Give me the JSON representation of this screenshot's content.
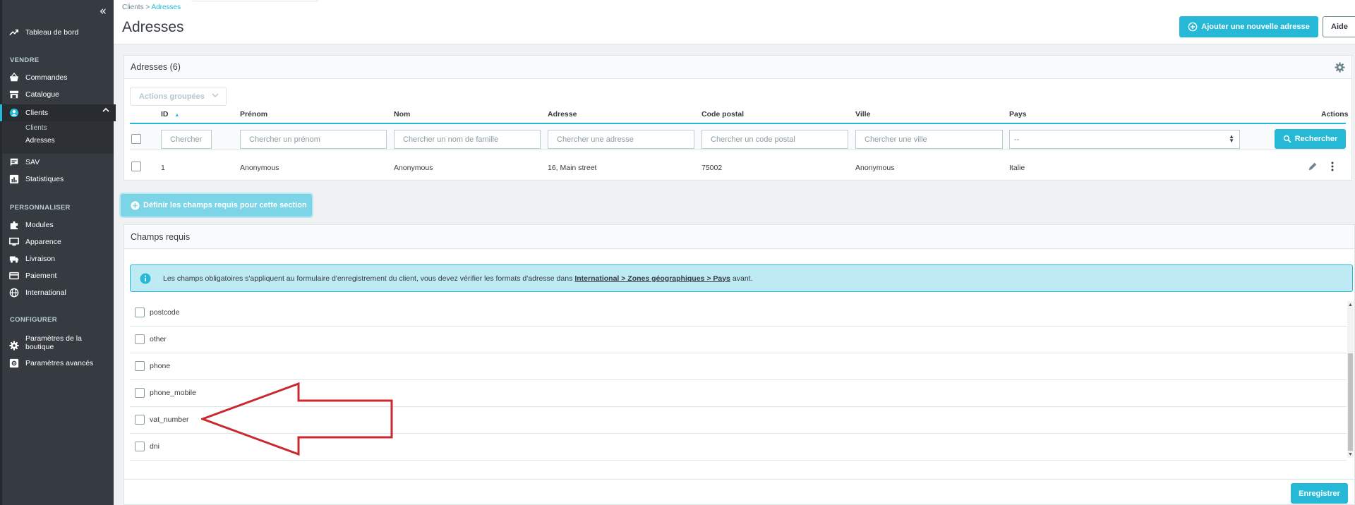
{
  "sidebar": {
    "collapse_icon": "«",
    "dashboard": "Tableau de bord",
    "section_sell": "VENDRE",
    "orders": "Commandes",
    "catalog": "Catalogue",
    "customers": "Clients",
    "sub_customers": "Clients",
    "sub_addresses": "Adresses",
    "support": "SAV",
    "stats": "Statistiques",
    "section_customize": "PERSONNALISER",
    "modules": "Modules",
    "appearance": "Apparence",
    "shipping": "Livraison",
    "payment": "Paiement",
    "international": "International",
    "section_configure": "CONFIGURER",
    "shop_params_1": "Paramètres de la",
    "shop_params_2": "boutique",
    "advanced_params": "Paramètres avancés"
  },
  "header": {
    "breadcrumb_parent": "Clients",
    "breadcrumb_sep": ">",
    "breadcrumb_current": "Adresses",
    "title": "Adresses",
    "add_button": "Ajouter une nouvelle adresse",
    "help_button": "Aide"
  },
  "addresses": {
    "title": "Adresses (6)",
    "bulk_actions": "Actions groupées",
    "columns": {
      "id": "ID",
      "sort_icon": "▲",
      "firstname": "Prénom",
      "lastname": "Nom",
      "address": "Adresse",
      "postcode": "Code postal",
      "city": "Ville",
      "country": "Pays",
      "actions": "Actions"
    },
    "filters": {
      "id": "Chercher",
      "firstname": "Chercher un prénom",
      "lastname": "Chercher un nom de famille",
      "address": "Chercher une adresse",
      "postcode": "Chercher un code postal",
      "city": "Chercher une ville",
      "country": "--",
      "search_button": "Rechercher"
    },
    "rows": [
      {
        "id": "1",
        "firstname": "Anonymous",
        "lastname": "Anonymous",
        "address": "16, Main street",
        "postcode": "75002",
        "city": "Anonymous",
        "country": "Italie"
      }
    ]
  },
  "define_button": "Définir les champs requis pour cette section",
  "required": {
    "title": "Champs requis",
    "alert_text": "Les champs obligatoires s'appliquent au formulaire d'enregistrement du client, vous devez vérifier les formats d'adresse dans",
    "alert_link": "International > Zones géographiques > Pays",
    "alert_suffix": "avant.",
    "fields": [
      "postcode",
      "other",
      "phone",
      "phone_mobile",
      "vat_number",
      "dni"
    ],
    "save_button": "Enregistrer"
  },
  "colors": {
    "accent": "#25b9d7",
    "sidebar": "#363a41",
    "annotation_arrow": "#c8282e"
  }
}
